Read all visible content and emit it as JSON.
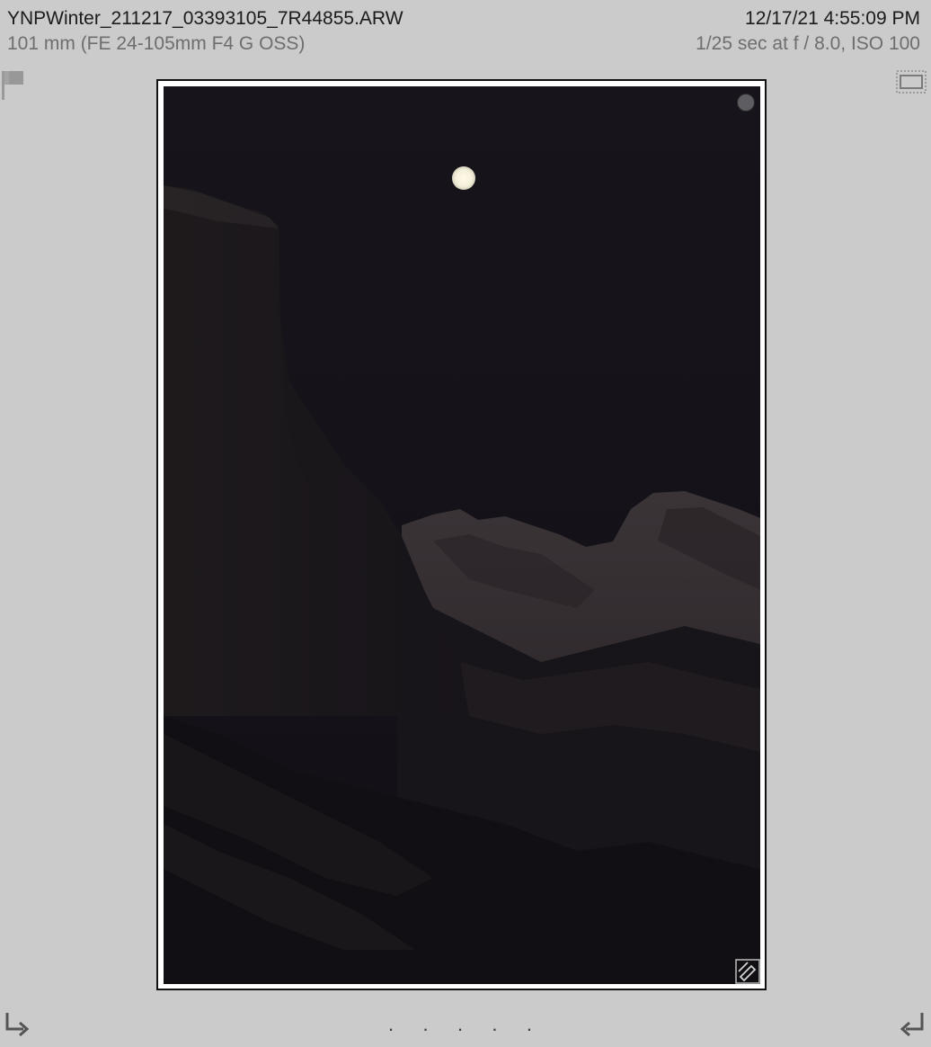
{
  "photo_cell": {
    "filename": "YNPWinter_211217_03393105_7R44855.ARW",
    "capture_time": "12/17/21 4:55:09 PM",
    "lens": "101 mm (FE 24-105mm F4 G OSS)",
    "exposure": "1/25 sec at f / 8.0, ISO 100"
  },
  "rating_dots": [
    ".",
    ".",
    ".",
    ".",
    "."
  ],
  "icons": {
    "flag": "flag-icon",
    "crop_ratio": "aspect-ratio-icon",
    "pick": "pick-status-dot",
    "edited": "edited-badge-icon",
    "rotate_left": "rotate-left-icon",
    "rotate_right": "rotate-right-icon"
  },
  "colors": {
    "background": "#cbcbcb",
    "photo_sky": "#141217",
    "moon": "#f4efd9",
    "frame": "#ffffff"
  }
}
